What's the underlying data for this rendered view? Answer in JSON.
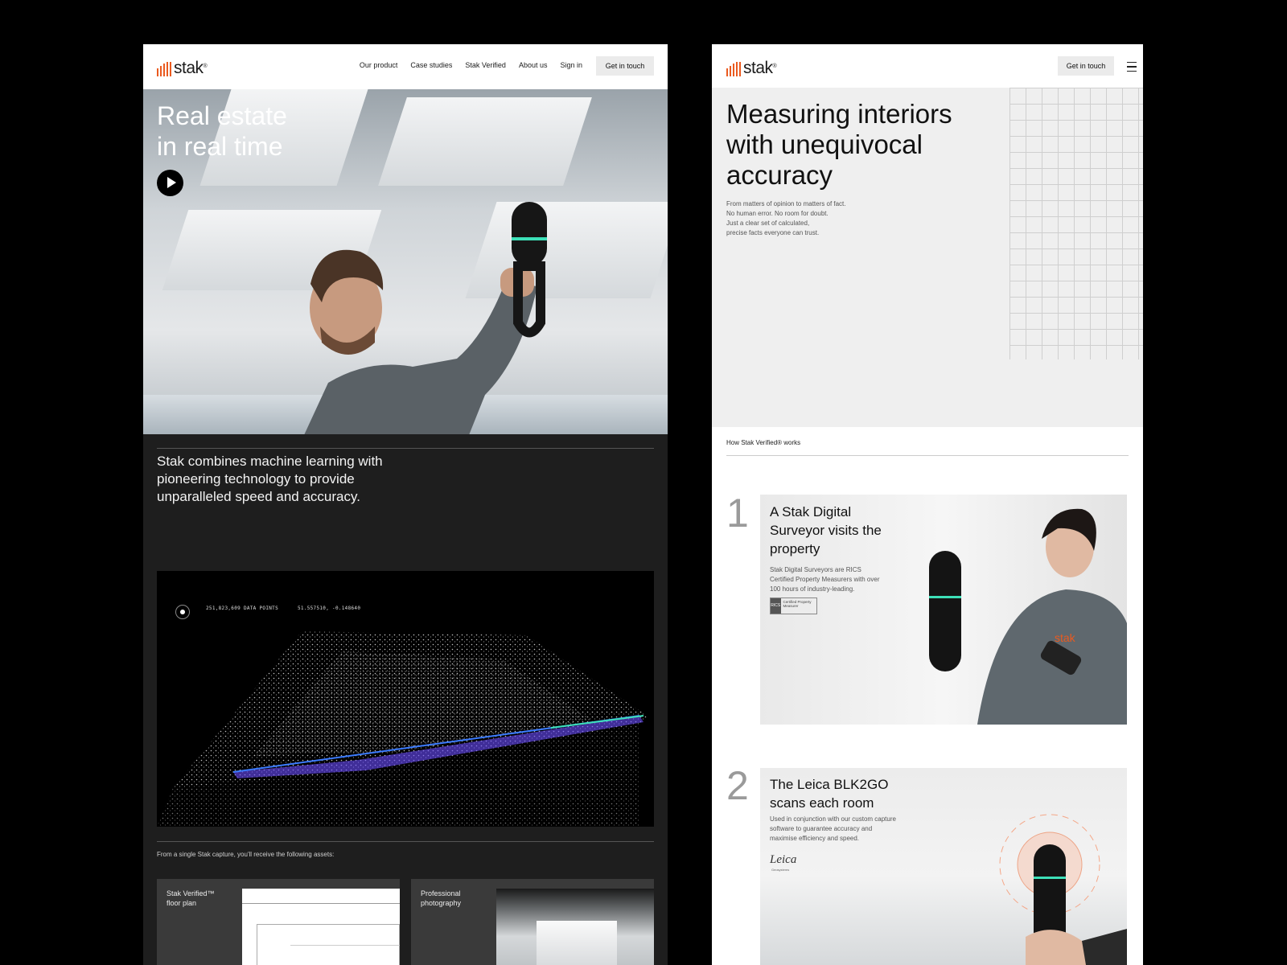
{
  "left": {
    "logo": "stak",
    "logo_mark": "®",
    "nav": [
      "Our product",
      "Case studies",
      "Stak Verified",
      "About us",
      "Sign in"
    ],
    "cta": "Get in touch",
    "hero_title_1": "Real estate",
    "hero_title_2": "in real time",
    "lead": "Stak combines machine learning with pioneering technology to provide unparalleled speed and accuracy.",
    "hud_points": "251,823,609 DATA POINTS",
    "hud_coords": "51.557510, -0.148640",
    "assets_intro": "From a single Stak capture, you'll receive the following assets:",
    "cards": [
      {
        "label": "Stak Verified™\nfloor plan"
      },
      {
        "label": "Professional\nphotography"
      }
    ]
  },
  "right": {
    "logo": "stak",
    "logo_mark": "®",
    "cta": "Get in touch",
    "title": "Measuring interiors with unequivocal accuracy",
    "sub": [
      "From matters of opinion to matters of fact.",
      "No human error. No room for doubt.",
      "Just a clear set of calculated,",
      "precise facts everyone can trust."
    ],
    "how": "How Stak Verified® works",
    "steps": [
      {
        "num": "1",
        "title": "A Stak Digital Surveyor visits the property",
        "body": "Stak Digital Surveyors are RICS Certified Property Measurers with over 100 hours of industry-leading.",
        "badge_org": "RICS",
        "badge_text": "Certified Property Measurer",
        "shirt_logo": "stak"
      },
      {
        "num": "2",
        "title": "The Leica BLK2GO scans each room",
        "body": "Used in conjunction with our custom capture software to guarantee accuracy and maximise efficiency and speed.",
        "brand": "Leica",
        "brand_sub": "Geosystems"
      }
    ]
  },
  "colors": {
    "accent": "#ea5a1f",
    "dark": "#1e1e1e",
    "scan": "#6a4cff"
  }
}
